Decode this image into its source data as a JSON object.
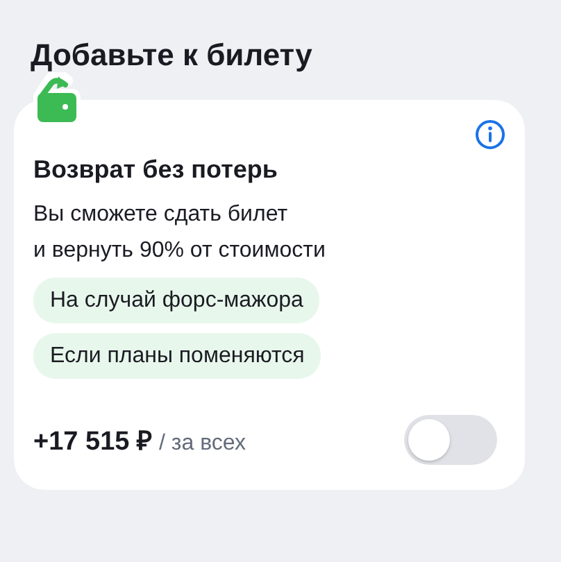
{
  "heading": "Добавьте к билету",
  "addon": {
    "title": "Возврат без потерь",
    "description": [
      "Вы сможете сдать билет",
      "и вернуть 90% от стоимости"
    ],
    "tags": [
      "На случай форс-мажора",
      "Если планы поменяются"
    ],
    "price": "+17 515 ₽",
    "price_note": "/ за всех",
    "enabled": false
  }
}
